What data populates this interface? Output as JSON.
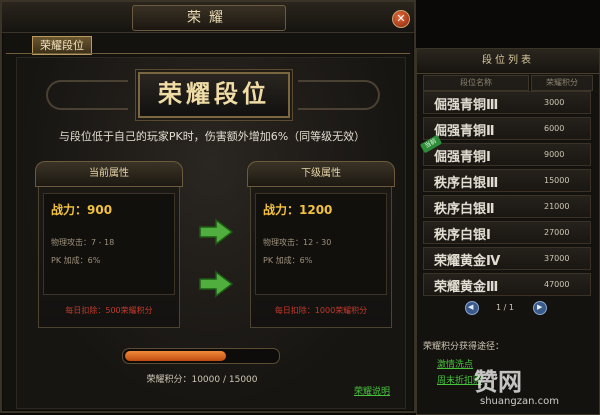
{
  "window": {
    "title": "荣耀",
    "close_icon": "close-icon"
  },
  "tab": {
    "label": "荣耀段位"
  },
  "banner": {
    "title": "荣耀段位"
  },
  "description": "与段位低于自己的玩家PK时，伤害额外增加6%（同等级无效）",
  "current": {
    "header": "当前属性",
    "power": "战力：900",
    "phys_attack": "物理攻击：7 - 18",
    "pk_bonus": "PK 加成：6%",
    "daily_deduct": "每日扣除：500荣耀积分"
  },
  "next": {
    "header": "下级属性",
    "power": "战力：1200",
    "phys_attack": "物理攻击：12 - 30",
    "pk_bonus": "PK 加成：6%",
    "daily_deduct": "每日扣除：1000荣耀积分"
  },
  "progress": {
    "fraction": 0.6667,
    "text": "荣耀积分：10000 / 15000"
  },
  "help_link": "荣耀说明",
  "rank_panel": {
    "title": "段位列表",
    "col_name": "段位名称",
    "col_points": "荣耀积分",
    "current_badge": "当前",
    "rows": [
      {
        "name": "倔强青铜Ⅲ",
        "points": "3000"
      },
      {
        "name": "倔强青铜Ⅱ",
        "points": "6000"
      },
      {
        "name": "倔强青铜Ⅰ",
        "points": "9000"
      },
      {
        "name": "秩序白银Ⅲ",
        "points": "15000"
      },
      {
        "name": "秩序白银Ⅱ",
        "points": "21000"
      },
      {
        "name": "秩序白银Ⅰ",
        "points": "27000"
      },
      {
        "name": "荣耀黄金Ⅳ",
        "points": "37000"
      },
      {
        "name": "荣耀黄金Ⅲ",
        "points": "47000"
      }
    ],
    "pager": "1 / 1",
    "obtain_title": "荣耀积分获得途径：",
    "obtain_links": [
      "激情洗点",
      "周末折扣购"
    ]
  },
  "watermark": {
    "big": "赞网",
    "small": "shuangzan.com"
  },
  "colors": {
    "accent_gold": "#f2c240",
    "link_green": "#46c33a",
    "deduct_red": "#c33a2a",
    "progress_orange": "#e06a22"
  }
}
